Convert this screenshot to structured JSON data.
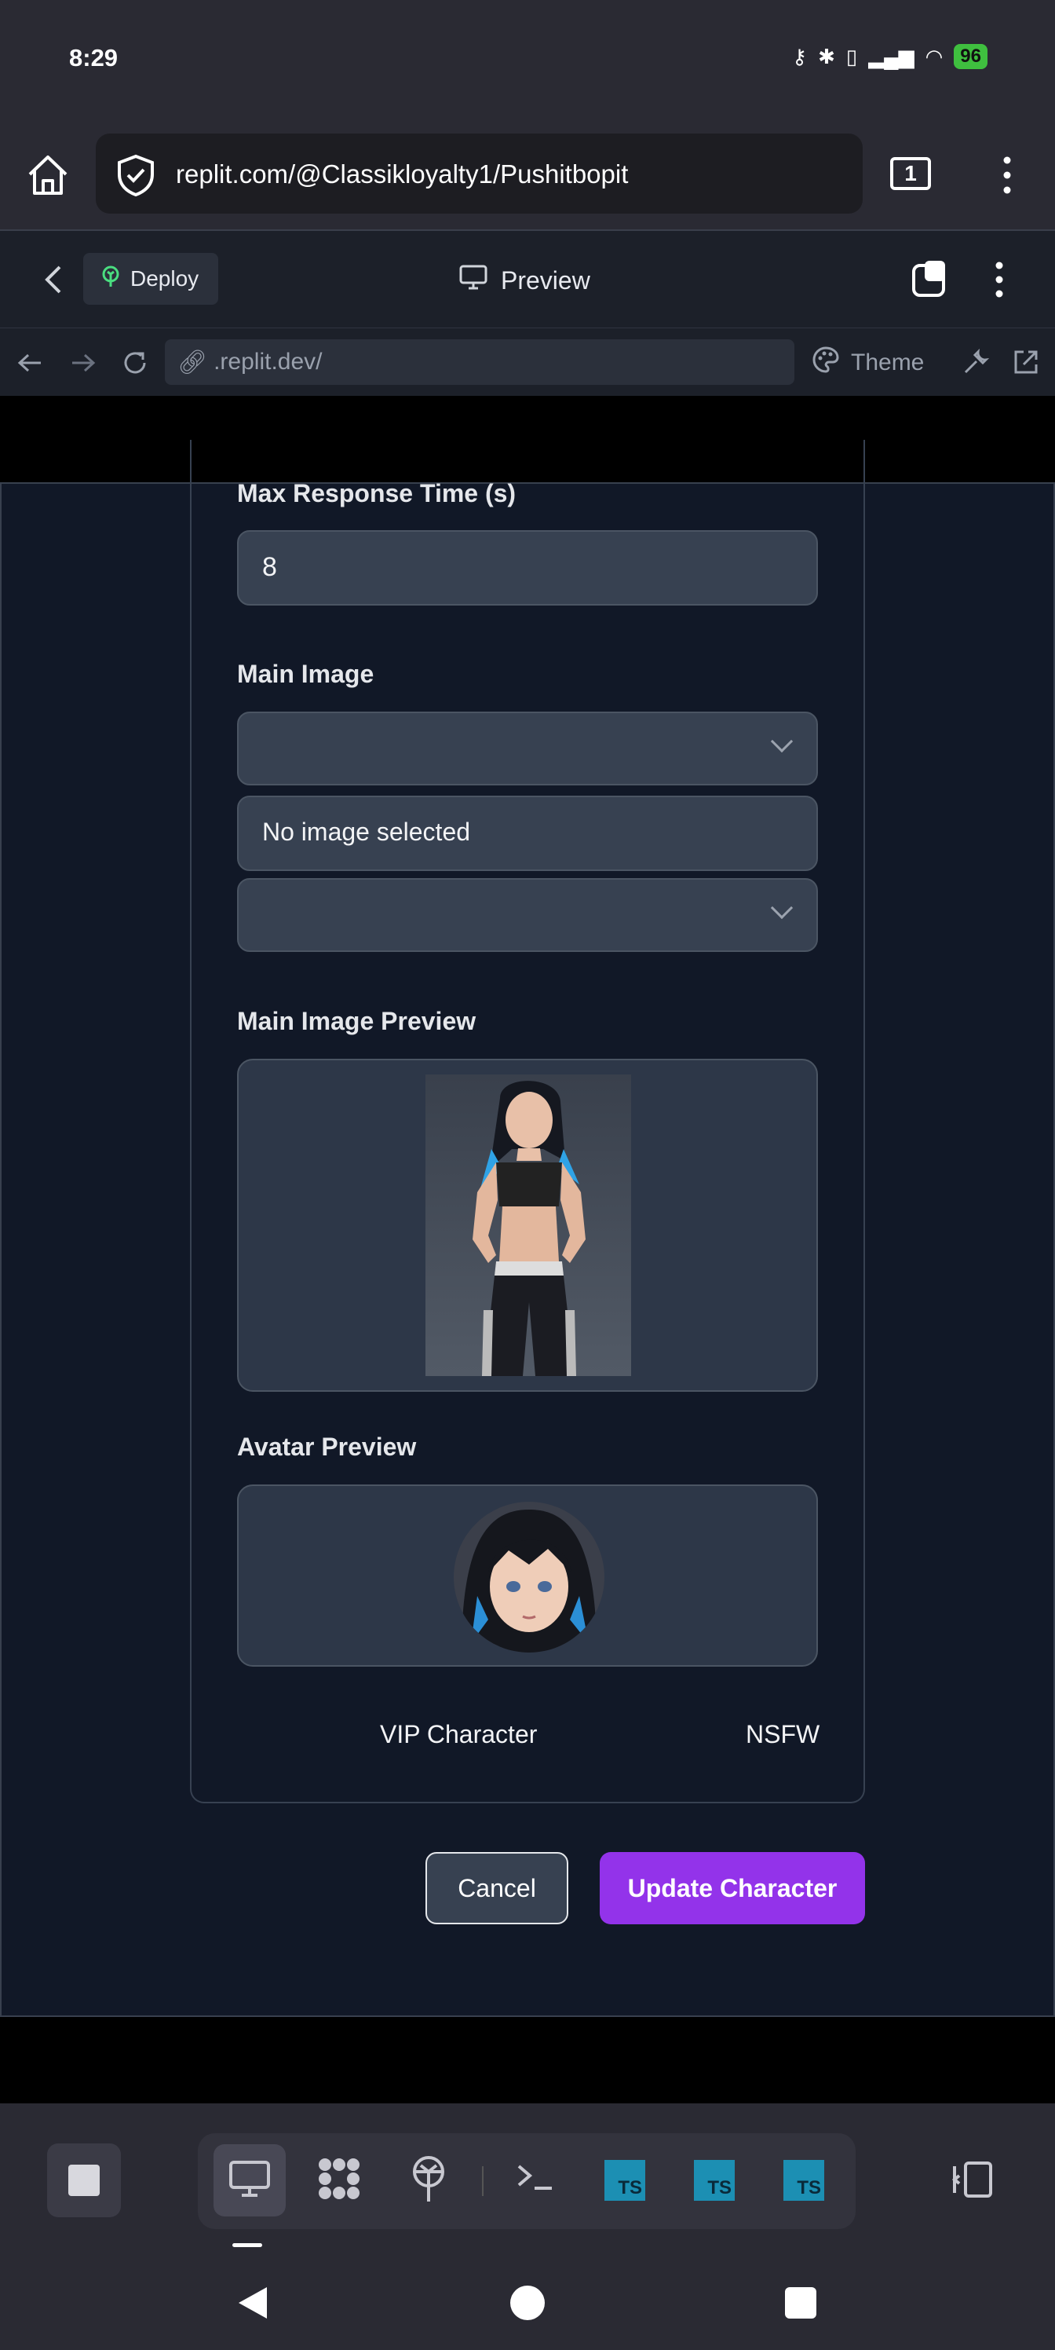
{
  "status": {
    "time": "8:29",
    "battery": "96"
  },
  "browser": {
    "url": "replit.com/@Classikloyalty1/Pushitbopit",
    "tab_count": "1"
  },
  "replit": {
    "deploy_label": "Deploy",
    "title": "Preview",
    "url": ".replit.dev/",
    "theme_label": "Theme"
  },
  "form": {
    "max_response": {
      "label": "Max Response Time (s)",
      "value": "8"
    },
    "main_image": {
      "label": "Main Image",
      "status": "No image selected"
    },
    "main_preview_label": "Main Image Preview",
    "avatar_preview_label": "Avatar Preview",
    "vip_label": "VIP Character",
    "nsfw_label": "NSFW",
    "cancel_label": "Cancel",
    "update_label": "Update Character"
  },
  "colors": {
    "accent": "#9333ea",
    "deploy_icon": "#4ade80",
    "ts_icon": "#1c8fb3"
  }
}
